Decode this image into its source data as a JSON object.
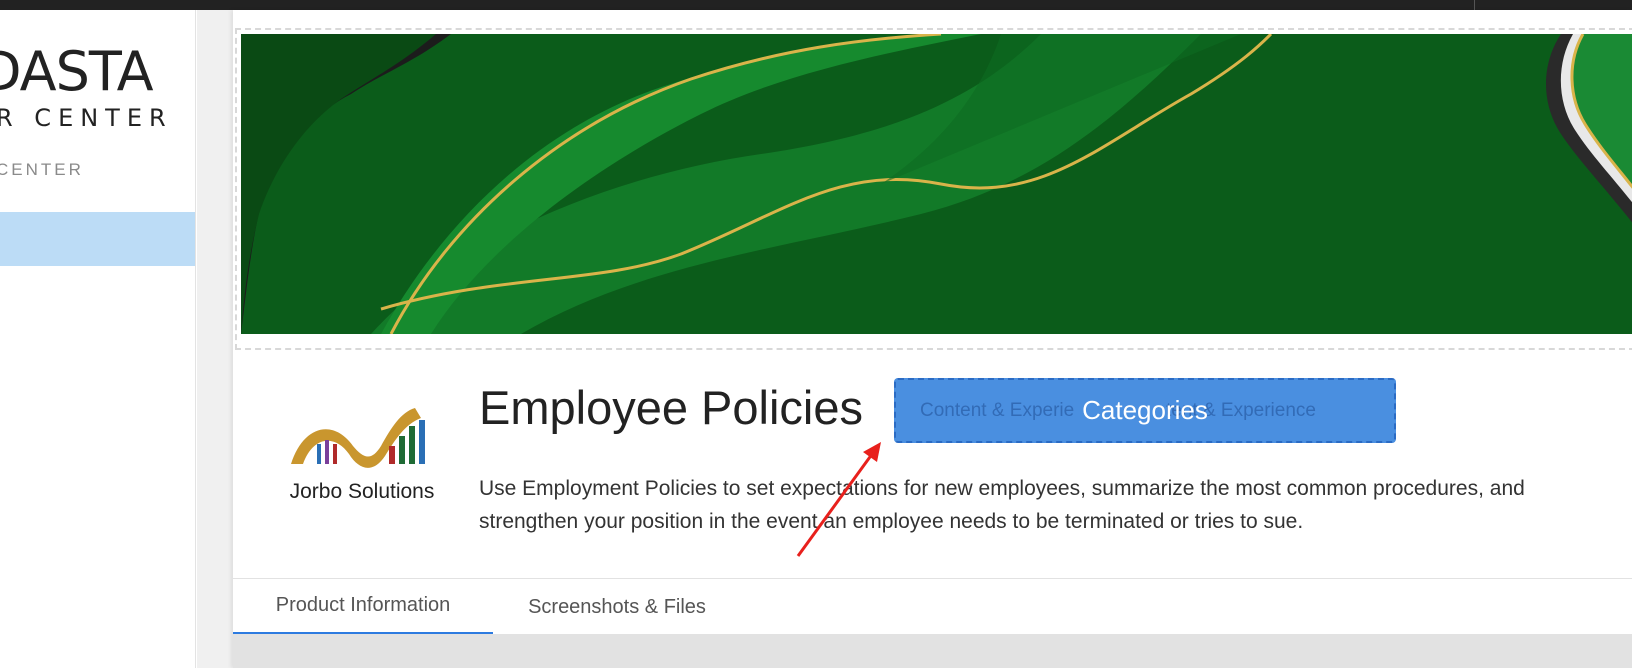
{
  "sidebar": {
    "brand_line1": "DASTA",
    "brand_line2": "R CENTER",
    "section_label": "CENTER"
  },
  "product": {
    "logo_text": "Jorbo Solutions",
    "title": "Employee Policies",
    "category_button_label": "Categories",
    "category_ghost_1": "Content & Experie",
    "category_ghost_2": "tent & Experience",
    "description": "Use Employment Policies to set expectations for new employees, summarize the most common procedures, and strengthen your position in the event an employee needs to be terminated or tries to sue."
  },
  "tabs": [
    {
      "label": "Product Information",
      "active": true
    },
    {
      "label": "Screenshots & Files",
      "active": false
    }
  ],
  "colors": {
    "banner_green": "#0b5c1a",
    "button_blue": "#4a8fe0",
    "active_tab_underline": "#2d7be0",
    "annotation_arrow": "#e8201c"
  }
}
